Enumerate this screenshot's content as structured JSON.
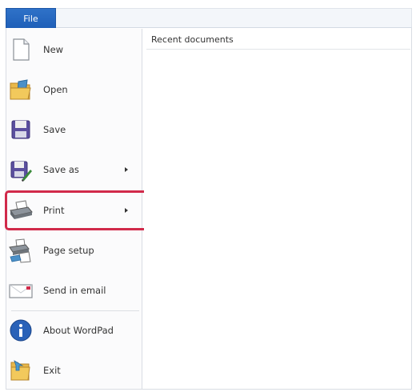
{
  "tabs": {
    "file": "File"
  },
  "menu": {
    "items": [
      {
        "id": "new",
        "label": "New",
        "icon": "new-document-icon",
        "has_submenu": false
      },
      {
        "id": "open",
        "label": "Open",
        "icon": "open-folder-icon",
        "has_submenu": false
      },
      {
        "id": "save",
        "label": "Save",
        "icon": "save-disk-icon",
        "has_submenu": false
      },
      {
        "id": "save-as",
        "label": "Save as",
        "icon": "save-as-icon",
        "has_submenu": true
      },
      {
        "id": "print",
        "label": "Print",
        "icon": "printer-icon",
        "has_submenu": true
      },
      {
        "id": "page-setup",
        "label": "Page setup",
        "icon": "page-setup-icon",
        "has_submenu": false
      },
      {
        "id": "send-email",
        "label": "Send in email",
        "icon": "email-icon",
        "has_submenu": false
      },
      {
        "id": "about",
        "label": "About WordPad",
        "icon": "info-icon",
        "has_submenu": false
      },
      {
        "id": "exit",
        "label": "Exit",
        "icon": "exit-icon",
        "has_submenu": false
      }
    ]
  },
  "recent": {
    "header": "Recent documents"
  },
  "colors": {
    "file_tab": "#1f5fb8",
    "highlight": "#d12a4a"
  }
}
